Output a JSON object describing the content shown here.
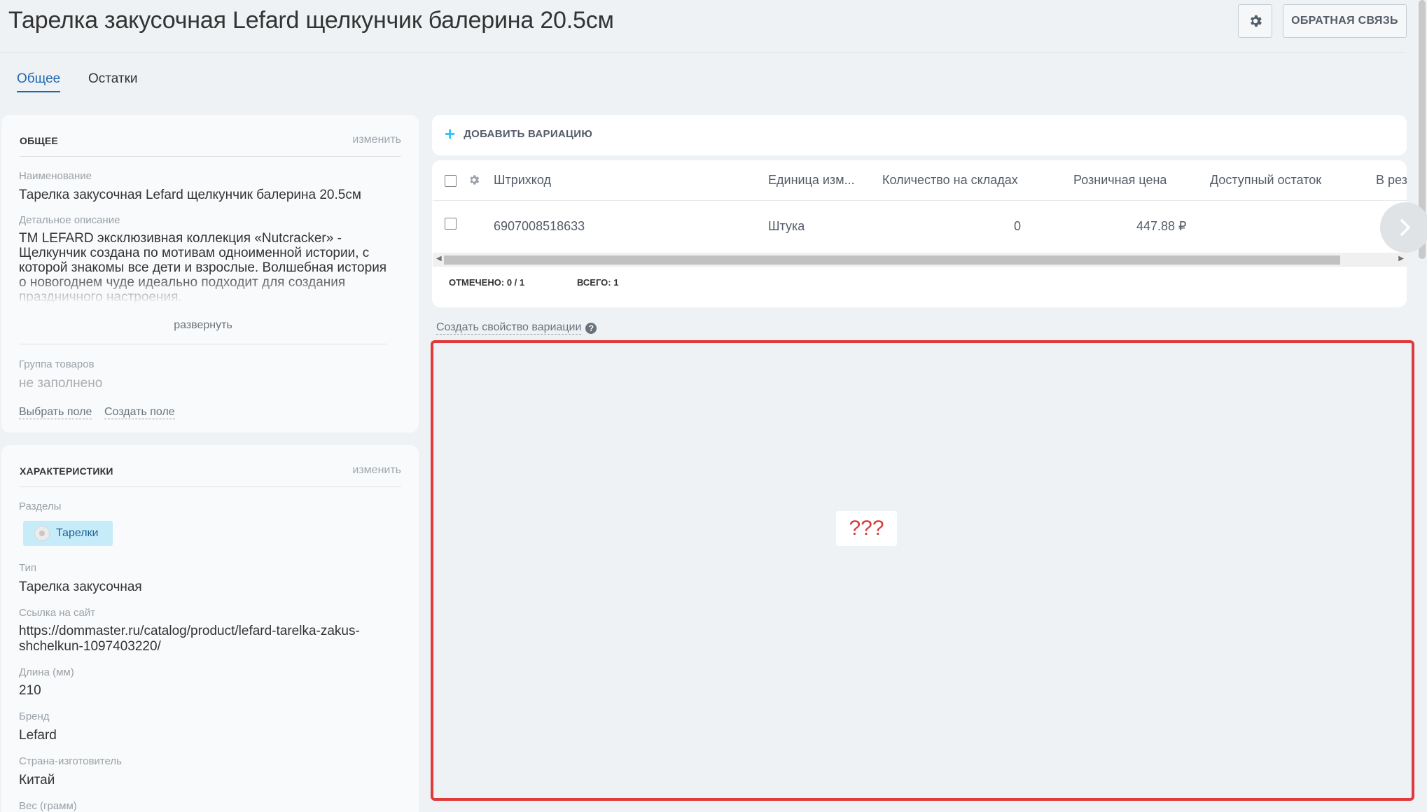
{
  "header": {
    "title": "Тарелка закусочная Lefard щелкунчик балерина 20.5см",
    "feedback_label": "ОБРАТНАЯ СВЯЗЬ"
  },
  "tabs": [
    {
      "label": "Общее",
      "active": true
    },
    {
      "label": "Остатки",
      "active": false
    }
  ],
  "general": {
    "title": "ОБЩЕЕ",
    "edit_label": "изменить",
    "name_label": "Наименование",
    "name_value": "Тарелка закусочная Lefard щелкунчик балерина 20.5см",
    "desc_label": "Детальное описание",
    "desc_value": "TM LEFARD эксклюзивная коллекция «Nutcracker» - Щелкунчик создана по мотивам одноименной истории, с которой знакомы все дети и взрослые. Волшебная история о новогоднем чуде идеально подходит для создания праздничного настроения.",
    "expand_label": "развернуть",
    "group_label": "Группа товаров",
    "group_value": "не заполнено",
    "choose_field": "Выбрать поле",
    "create_field": "Создать поле"
  },
  "characteristics": {
    "title": "ХАРАКТЕРИСТИКИ",
    "edit_label": "изменить",
    "sections_label": "Разделы",
    "section_tag": "Тарелки",
    "type_label": "Тип",
    "type_value": "Тарелка закусочная",
    "link_label": "Ссылка на сайт",
    "link_value_line1": "https://dommaster.ru/catalog/product/lefard-tarelka-zakus-",
    "link_value_line2": "shchelkun-1097403220/",
    "length_label": "Длина (мм)",
    "length_value": "210",
    "brand_label": "Бренд",
    "brand_value": "Lefard",
    "country_label": "Страна-изготовитель",
    "country_value": "Китай",
    "weight_label": "Вес (грамм)"
  },
  "variations": {
    "add_label": "ДОБАВИТЬ ВАРИАЦИЮ",
    "columns": [
      "Штрихкод",
      "Единица изм...",
      "Количество на складах",
      "Розничная цена",
      "Доступный остаток",
      "В резе"
    ],
    "rows": [
      {
        "barcode": "6907008518633",
        "unit": "Штука",
        "qty": "0",
        "price": "447.88 ₽",
        "available": "",
        "reserved": ""
      }
    ],
    "checked_label": "ОТМЕЧЕНО:",
    "checked_value": "0 / 1",
    "total_label": "ВСЕГО:",
    "total_value": "1"
  },
  "create_property_label": "Создать свойство вариации",
  "placeholder_text": "???"
}
